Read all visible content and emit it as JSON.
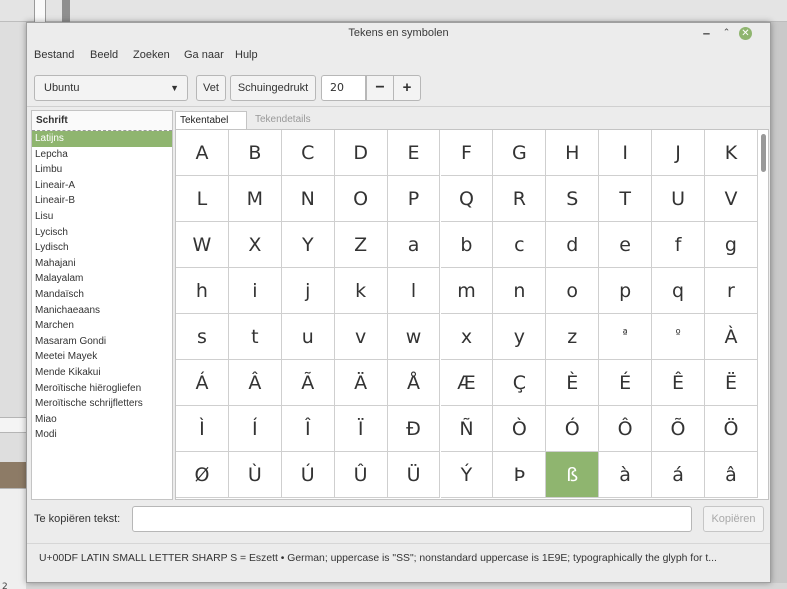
{
  "window": {
    "title": "Tekens en symbolen",
    "minimize_label": "‒",
    "maximize_label": "⌃",
    "close_label": "✕",
    "accent": "#8fb56f"
  },
  "menu": [
    "Bestand",
    "Beeld",
    "Zoeken",
    "Ga naar",
    "Hulp"
  ],
  "toolbar": {
    "font": "Ubuntu",
    "bold_label": "Vet",
    "italic_label": "Schuingedrukt",
    "size": "20",
    "decrease_label": "−",
    "increase_label": "+"
  },
  "scripts": {
    "header": "Schrift",
    "selected": "Latijns",
    "items": [
      "Latijns",
      "Lepcha",
      "Limbu",
      "Lineair-A",
      "Lineair-B",
      "Lisu",
      "Lycisch",
      "Lydisch",
      "Mahajani",
      "Malayalam",
      "Mandaïsch",
      "Manichaeaans",
      "Marchen",
      "Masaram Gondi",
      "Meetei Mayek",
      "Mende Kikakui",
      "Meroïtische hiërogliefen",
      "Meroïtische schrijfletters",
      "Miao",
      "Modi"
    ]
  },
  "tabs": [
    {
      "label": "Tekentabel",
      "active": true
    },
    {
      "label": "Tekendetails",
      "active": false
    }
  ],
  "characters": {
    "selected": "ß",
    "rows": [
      [
        "A",
        "B",
        "C",
        "D",
        "E",
        "F",
        "G",
        "H",
        "I",
        "J",
        "K"
      ],
      [
        "L",
        "M",
        "N",
        "O",
        "P",
        "Q",
        "R",
        "S",
        "T",
        "U",
        "V"
      ],
      [
        "W",
        "X",
        "Y",
        "Z",
        "a",
        "b",
        "c",
        "d",
        "e",
        "f",
        "g"
      ],
      [
        "h",
        "i",
        "j",
        "k",
        "l",
        "m",
        "n",
        "o",
        "p",
        "q",
        "r"
      ],
      [
        "s",
        "t",
        "u",
        "v",
        "w",
        "x",
        "y",
        "z",
        "ª",
        "º",
        "À"
      ],
      [
        "Á",
        "Â",
        "Ã",
        "Ä",
        "Å",
        "Æ",
        "Ç",
        "È",
        "É",
        "Ê",
        "Ë"
      ],
      [
        "Ì",
        "Í",
        "Î",
        "Ï",
        "Ð",
        "Ñ",
        "Ò",
        "Ó",
        "Ô",
        "Õ",
        "Ö"
      ],
      [
        "Ø",
        "Ù",
        "Ú",
        "Û",
        "Ü",
        "Ý",
        "Þ",
        "ß",
        "à",
        "á",
        "â"
      ]
    ]
  },
  "copy": {
    "label": "Te kopiëren tekst:",
    "value": "",
    "button": "Kopiëren"
  },
  "status": "U+00DF LATIN SMALL LETTER SHARP S  = Eszett  • German; uppercase is \"SS\"; nonstandard uppercase is 1E9E; typographically the glyph for t...",
  "background_fragment_text": "2"
}
